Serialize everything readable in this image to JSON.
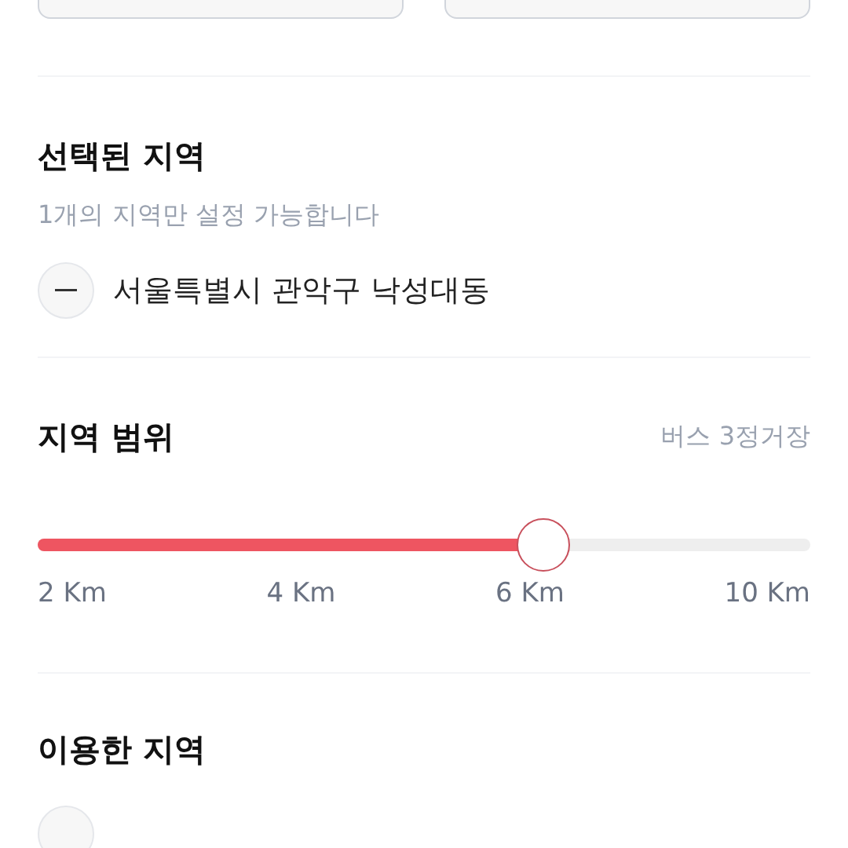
{
  "selected_region": {
    "title": "선택된 지역",
    "note": "1개의 지역만 설정 가능합니다",
    "items": [
      {
        "name": "서울특별시 관악구 낙성대동"
      }
    ]
  },
  "range": {
    "title": "지역 범위",
    "summary": "버스 3정거장",
    "level": 0.654,
    "ticks": [
      "2 Km",
      "4 Km",
      "6 Km",
      "10 Km"
    ]
  },
  "used_regions": {
    "title": "이용한 지역"
  }
}
